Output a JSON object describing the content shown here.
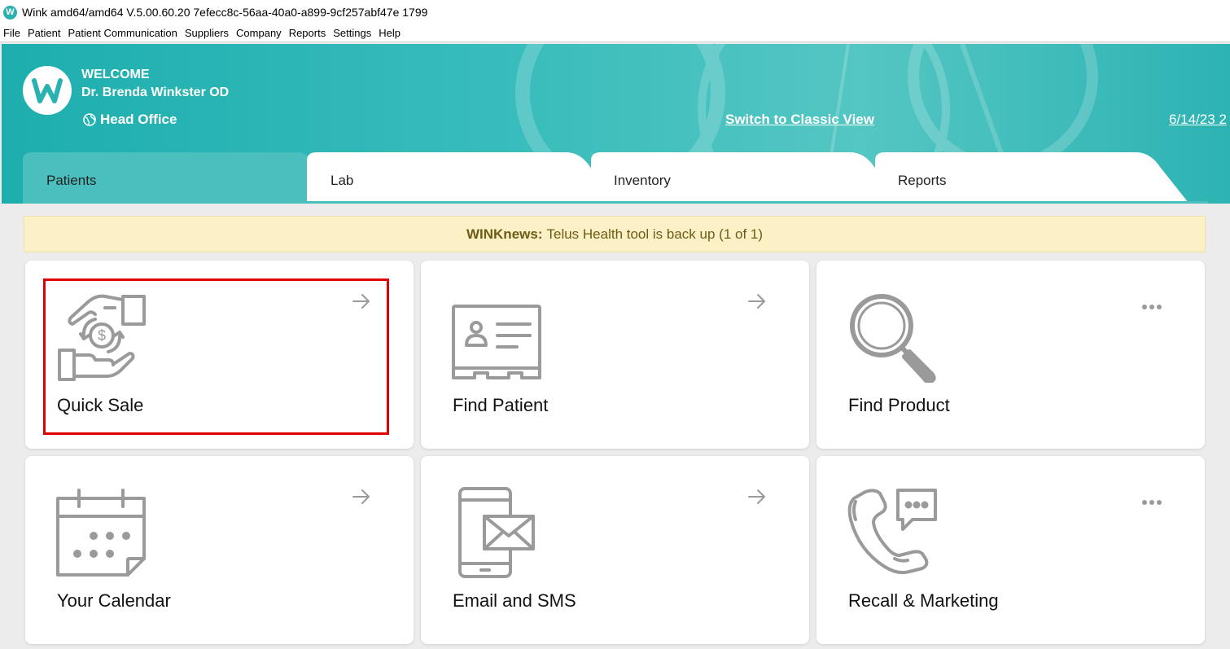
{
  "window": {
    "title": "Wink amd64/amd64 V.5.00.60.20 7efecc8c-56aa-40a0-a899-9cf257abf47e 1799",
    "app_icon_letter": "W"
  },
  "menu": [
    "File",
    "Patient",
    "Patient Communication",
    "Suppliers",
    "Company",
    "Reports",
    "Settings",
    "Help"
  ],
  "header": {
    "welcome": "WELCOME",
    "user_name": "Dr. Brenda Winkster OD",
    "office": "Head Office",
    "switch_view": "Switch to Classic View",
    "date": "6/14/23 2"
  },
  "tabs": [
    {
      "label": "Patients",
      "active": true
    },
    {
      "label": "Lab",
      "active": false
    },
    {
      "label": "Inventory",
      "active": false
    },
    {
      "label": "Reports",
      "active": false
    }
  ],
  "news": {
    "brand": "WINKnews:",
    "message": "Telus Health tool is back up (1 of 1)"
  },
  "cards": [
    {
      "label": "Quick Sale",
      "icon": "quick-sale-icon",
      "action": "arrow",
      "highlighted": true
    },
    {
      "label": "Find Patient",
      "icon": "id-card-icon",
      "action": "arrow"
    },
    {
      "label": "Find Product",
      "icon": "magnifier-icon",
      "action": "more"
    },
    {
      "label": "Your Calendar",
      "icon": "calendar-icon",
      "action": "arrow"
    },
    {
      "label": "Email and SMS",
      "icon": "phone-mail-icon",
      "action": "arrow"
    },
    {
      "label": "Recall & Marketing",
      "icon": "phone-chat-icon",
      "action": "more"
    }
  ],
  "colors": {
    "header_teal": "#2db3b3",
    "tab_active": "#4bbfbe",
    "news_bg": "#fbf0c6",
    "highlight": "#e00000",
    "icon_gray": "#9a9a9a"
  }
}
